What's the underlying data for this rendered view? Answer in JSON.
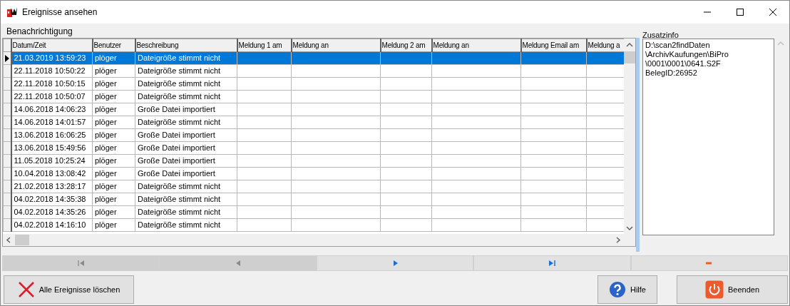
{
  "window": {
    "title": "Ereignisse ansehen"
  },
  "section_label": "Benachrichtigung",
  "table": {
    "columns": [
      "Datum/Zeit",
      "Benutzer",
      "Beschreibung",
      "Meldung 1 am",
      "Meldung an",
      "Meldung 2 am",
      "Meldung an",
      "Meldung Email am",
      "Meldung a"
    ],
    "rows": [
      {
        "datetime": "21.03.2019 13:59:23",
        "user": "plöger",
        "description": "Dateigröße stimmt nicht",
        "selected": true
      },
      {
        "datetime": "22.11.2018 10:50:22",
        "user": "plöger",
        "description": "Dateigröße stimmt nicht",
        "selected": false
      },
      {
        "datetime": "22.11.2018 10:50:15",
        "user": "plöger",
        "description": "Dateigröße stimmt nicht",
        "selected": false
      },
      {
        "datetime": "22.11.2018 10:50:07",
        "user": "plöger",
        "description": "Dateigröße stimmt nicht",
        "selected": false
      },
      {
        "datetime": "14.06.2018 14:06:23",
        "user": "plöger",
        "description": "Große Datei importiert",
        "selected": false
      },
      {
        "datetime": "14.06.2018 14:01:57",
        "user": "plöger",
        "description": "Dateigröße stimmt nicht",
        "selected": false
      },
      {
        "datetime": "13.06.2018 16:06:25",
        "user": "plöger",
        "description": "Große Datei importiert",
        "selected": false
      },
      {
        "datetime": "13.06.2018 15:49:56",
        "user": "plöger",
        "description": "Große Datei importiert",
        "selected": false
      },
      {
        "datetime": "11.05.2018 10:25:24",
        "user": "plöger",
        "description": "Große Datei importiert",
        "selected": false
      },
      {
        "datetime": "10.04.2018 13:08:42",
        "user": "plöger",
        "description": "Große Datei importiert",
        "selected": false
      },
      {
        "datetime": "21.02.2018 13:28:17",
        "user": "plöger",
        "description": "Dateigröße stimmt nicht",
        "selected": false
      },
      {
        "datetime": "04.02.2018 14:35:38",
        "user": "plöger",
        "description": "Dateigröße stimmt nicht",
        "selected": false
      },
      {
        "datetime": "04.02.2018 14:35:26",
        "user": "plöger",
        "description": "Dateigröße stimmt nicht",
        "selected": false
      },
      {
        "datetime": "04.02.2018 14:16:10",
        "user": "plöger",
        "description": "Dateigröße stimmt nicht",
        "selected": false
      }
    ]
  },
  "info_panel": {
    "label": "Zusatzinfo",
    "lines": [
      "D:\\scan2findDaten",
      "\\ArchivKaufungen\\BiPro",
      "\\0001\\0001\\0641.S2F",
      "BelegID:26952"
    ]
  },
  "navigator": [
    {
      "kind": "first",
      "disabled": true
    },
    {
      "kind": "prior",
      "disabled": true
    },
    {
      "kind": "next",
      "disabled": false
    },
    {
      "kind": "last",
      "disabled": false
    },
    {
      "kind": "delete",
      "disabled": false
    }
  ],
  "buttons": [
    {
      "kind": "clear",
      "label": "Alle Ereignisse löschen"
    },
    {
      "kind": "help",
      "label": "Hilfe"
    },
    {
      "kind": "close",
      "label": "Beenden"
    }
  ]
}
